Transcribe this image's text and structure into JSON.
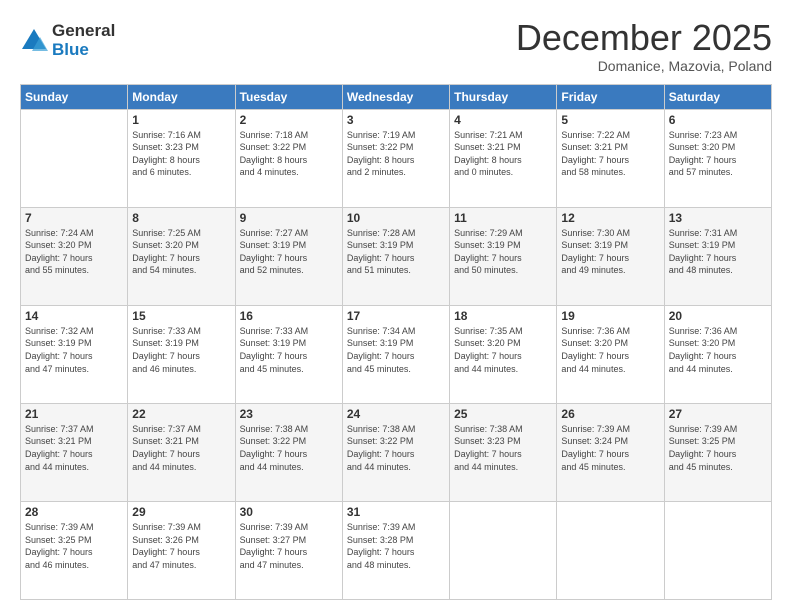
{
  "logo": {
    "general": "General",
    "blue": "Blue"
  },
  "header": {
    "month": "December 2025",
    "location": "Domanice, Mazovia, Poland"
  },
  "days_of_week": [
    "Sunday",
    "Monday",
    "Tuesday",
    "Wednesday",
    "Thursday",
    "Friday",
    "Saturday"
  ],
  "weeks": [
    [
      {
        "day": "",
        "info": ""
      },
      {
        "day": "1",
        "info": "Sunrise: 7:16 AM\nSunset: 3:23 PM\nDaylight: 8 hours\nand 6 minutes."
      },
      {
        "day": "2",
        "info": "Sunrise: 7:18 AM\nSunset: 3:22 PM\nDaylight: 8 hours\nand 4 minutes."
      },
      {
        "day": "3",
        "info": "Sunrise: 7:19 AM\nSunset: 3:22 PM\nDaylight: 8 hours\nand 2 minutes."
      },
      {
        "day": "4",
        "info": "Sunrise: 7:21 AM\nSunset: 3:21 PM\nDaylight: 8 hours\nand 0 minutes."
      },
      {
        "day": "5",
        "info": "Sunrise: 7:22 AM\nSunset: 3:21 PM\nDaylight: 7 hours\nand 58 minutes."
      },
      {
        "day": "6",
        "info": "Sunrise: 7:23 AM\nSunset: 3:20 PM\nDaylight: 7 hours\nand 57 minutes."
      }
    ],
    [
      {
        "day": "7",
        "info": "Sunrise: 7:24 AM\nSunset: 3:20 PM\nDaylight: 7 hours\nand 55 minutes."
      },
      {
        "day": "8",
        "info": "Sunrise: 7:25 AM\nSunset: 3:20 PM\nDaylight: 7 hours\nand 54 minutes."
      },
      {
        "day": "9",
        "info": "Sunrise: 7:27 AM\nSunset: 3:19 PM\nDaylight: 7 hours\nand 52 minutes."
      },
      {
        "day": "10",
        "info": "Sunrise: 7:28 AM\nSunset: 3:19 PM\nDaylight: 7 hours\nand 51 minutes."
      },
      {
        "day": "11",
        "info": "Sunrise: 7:29 AM\nSunset: 3:19 PM\nDaylight: 7 hours\nand 50 minutes."
      },
      {
        "day": "12",
        "info": "Sunrise: 7:30 AM\nSunset: 3:19 PM\nDaylight: 7 hours\nand 49 minutes."
      },
      {
        "day": "13",
        "info": "Sunrise: 7:31 AM\nSunset: 3:19 PM\nDaylight: 7 hours\nand 48 minutes."
      }
    ],
    [
      {
        "day": "14",
        "info": "Sunrise: 7:32 AM\nSunset: 3:19 PM\nDaylight: 7 hours\nand 47 minutes."
      },
      {
        "day": "15",
        "info": "Sunrise: 7:33 AM\nSunset: 3:19 PM\nDaylight: 7 hours\nand 46 minutes."
      },
      {
        "day": "16",
        "info": "Sunrise: 7:33 AM\nSunset: 3:19 PM\nDaylight: 7 hours\nand 45 minutes."
      },
      {
        "day": "17",
        "info": "Sunrise: 7:34 AM\nSunset: 3:19 PM\nDaylight: 7 hours\nand 45 minutes."
      },
      {
        "day": "18",
        "info": "Sunrise: 7:35 AM\nSunset: 3:20 PM\nDaylight: 7 hours\nand 44 minutes."
      },
      {
        "day": "19",
        "info": "Sunrise: 7:36 AM\nSunset: 3:20 PM\nDaylight: 7 hours\nand 44 minutes."
      },
      {
        "day": "20",
        "info": "Sunrise: 7:36 AM\nSunset: 3:20 PM\nDaylight: 7 hours\nand 44 minutes."
      }
    ],
    [
      {
        "day": "21",
        "info": "Sunrise: 7:37 AM\nSunset: 3:21 PM\nDaylight: 7 hours\nand 44 minutes."
      },
      {
        "day": "22",
        "info": "Sunrise: 7:37 AM\nSunset: 3:21 PM\nDaylight: 7 hours\nand 44 minutes."
      },
      {
        "day": "23",
        "info": "Sunrise: 7:38 AM\nSunset: 3:22 PM\nDaylight: 7 hours\nand 44 minutes."
      },
      {
        "day": "24",
        "info": "Sunrise: 7:38 AM\nSunset: 3:22 PM\nDaylight: 7 hours\nand 44 minutes."
      },
      {
        "day": "25",
        "info": "Sunrise: 7:38 AM\nSunset: 3:23 PM\nDaylight: 7 hours\nand 44 minutes."
      },
      {
        "day": "26",
        "info": "Sunrise: 7:39 AM\nSunset: 3:24 PM\nDaylight: 7 hours\nand 45 minutes."
      },
      {
        "day": "27",
        "info": "Sunrise: 7:39 AM\nSunset: 3:25 PM\nDaylight: 7 hours\nand 45 minutes."
      }
    ],
    [
      {
        "day": "28",
        "info": "Sunrise: 7:39 AM\nSunset: 3:25 PM\nDaylight: 7 hours\nand 46 minutes."
      },
      {
        "day": "29",
        "info": "Sunrise: 7:39 AM\nSunset: 3:26 PM\nDaylight: 7 hours\nand 47 minutes."
      },
      {
        "day": "30",
        "info": "Sunrise: 7:39 AM\nSunset: 3:27 PM\nDaylight: 7 hours\nand 47 minutes."
      },
      {
        "day": "31",
        "info": "Sunrise: 7:39 AM\nSunset: 3:28 PM\nDaylight: 7 hours\nand 48 minutes."
      },
      {
        "day": "",
        "info": ""
      },
      {
        "day": "",
        "info": ""
      },
      {
        "day": "",
        "info": ""
      }
    ]
  ]
}
